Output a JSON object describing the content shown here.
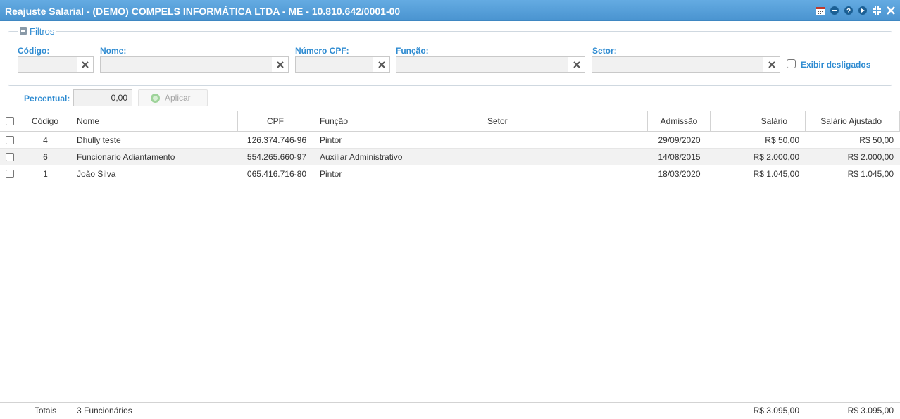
{
  "window": {
    "title": "Reajuste Salarial - (DEMO) COMPELS INFORMÁTICA LTDA - ME - 10.810.642/0001-00",
    "icons": [
      "calendar-icon",
      "minimize-icon",
      "help-icon",
      "play-icon",
      "collapse-icon",
      "close-icon"
    ]
  },
  "filters": {
    "legend": "Filtros",
    "codigo_label": "Código:",
    "nome_label": "Nome:",
    "cpf_label": "Número CPF:",
    "funcao_label": "Função:",
    "setor_label": "Setor:",
    "codigo_value": "",
    "nome_value": "",
    "cpf_value": "",
    "funcao_value": "",
    "setor_value": "",
    "exibir_desligados_label": "Exibir desligados",
    "exibir_desligados_checked": false
  },
  "percentual": {
    "label": "Percentual:",
    "value": "0,00",
    "apply_label": "Aplicar"
  },
  "table": {
    "columns": [
      "Código",
      "Nome",
      "CPF",
      "Função",
      "Setor",
      "Admissão",
      "Salário",
      "Salário Ajustado"
    ],
    "rows": [
      {
        "codigo": "4",
        "nome": "Dhully teste",
        "cpf": "126.374.746-96",
        "funcao": "Pintor",
        "setor": "",
        "admissao": "29/09/2020",
        "salario": "R$ 50,00",
        "salario_ajustado": "R$ 50,00"
      },
      {
        "codigo": "6",
        "nome": "Funcionario Adiantamento",
        "cpf": "554.265.660-97",
        "funcao": "Auxiliar Administrativo",
        "setor": "",
        "admissao": "14/08/2015",
        "salario": "R$ 2.000,00",
        "salario_ajustado": "R$ 2.000,00"
      },
      {
        "codigo": "1",
        "nome": "João Silva",
        "cpf": "065.416.716-80",
        "funcao": "Pintor",
        "setor": "",
        "admissao": "18/03/2020",
        "salario": "R$ 1.045,00",
        "salario_ajustado": "R$ 1.045,00"
      }
    ]
  },
  "totals": {
    "label": "Totais",
    "count": "3 Funcionários",
    "salario": "R$ 3.095,00",
    "salario_ajustado": "R$ 3.095,00"
  },
  "colors": {
    "titlebar": "#4f9bd6",
    "label_blue": "#2e8bd1",
    "alt_row": "#f2f2f2"
  }
}
